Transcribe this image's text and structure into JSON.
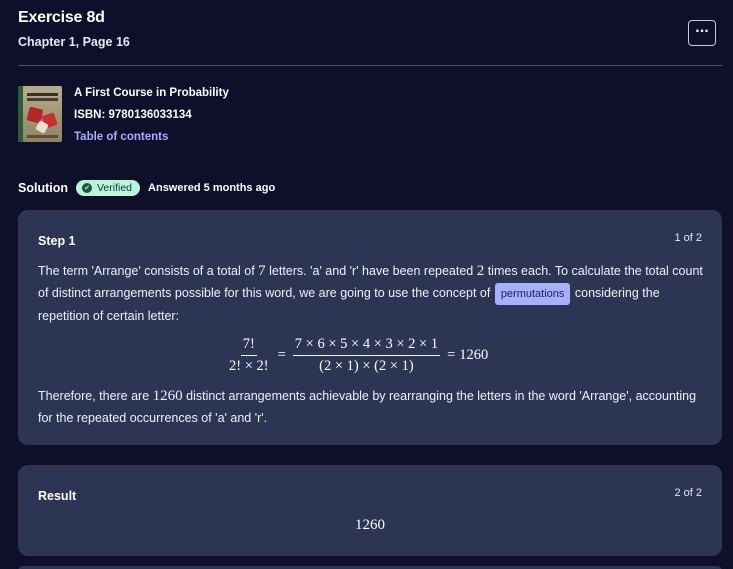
{
  "header": {
    "title": "Exercise 8d",
    "subtitle": "Chapter 1, Page 16",
    "more_label": "···"
  },
  "book": {
    "title": "A First Course in Probability",
    "isbn": "ISBN: 9780136033134",
    "toc_link": "Table of contents"
  },
  "solution": {
    "label": "Solution",
    "verified_label": "Verified",
    "answered": "Answered 5 months ago"
  },
  "step": {
    "label": "Step 1",
    "count": "1 of 2",
    "para1_a": "The term 'Arrange' consists of a total of ",
    "para1_num1": "7",
    "para1_b": " letters. 'a' and 'r' have been repeated ",
    "para1_num2": "2",
    "para1_c": " times each. To calculate the total count of distinct arrangements possible for this word, we are going to use the concept of ",
    "concept": "permutations",
    "para1_d": " considering the repetition of certain letter:",
    "equation": {
      "frac1_num": "7!",
      "frac1_den": "2! × 2!",
      "equals1": "=",
      "frac2_num": "7 × 6 × 5 × 4 × 3 × 2 × 1",
      "frac2_den": "(2 × 1) × (2 × 1)",
      "equals2": "=",
      "result": "1260"
    },
    "para2_a": "Therefore, there are ",
    "para2_num": "1260",
    "para2_b": " distinct arrangements achievable by rearranging the letters in the word 'Arrange', accounting for the repeated occurrences of 'a' and 'r'."
  },
  "result": {
    "label": "Result",
    "count": "2 of 2",
    "value": "1260"
  },
  "colors": {
    "background": "#0f0f2b",
    "card": "#2c3553",
    "link": "#a7adff",
    "chip": "#a6b0ff",
    "verified": "#b8f5dc"
  }
}
